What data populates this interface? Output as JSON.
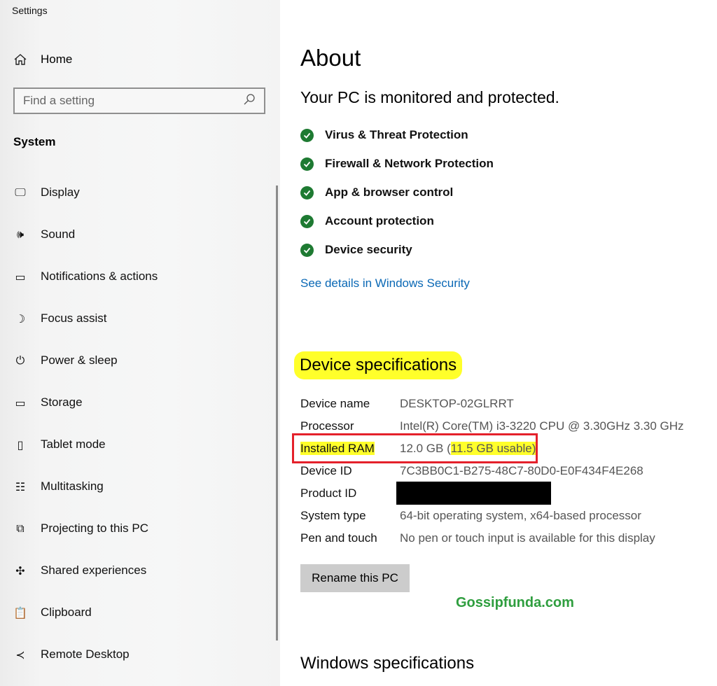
{
  "app": {
    "title": "Settings"
  },
  "sidebar": {
    "home": "Home",
    "search_placeholder": "Find a setting",
    "section": "System",
    "items": [
      {
        "label": "Display",
        "icon": "monitor-icon"
      },
      {
        "label": "Sound",
        "icon": "speaker-icon"
      },
      {
        "label": "Notifications & actions",
        "icon": "notification-icon"
      },
      {
        "label": "Focus assist",
        "icon": "moon-icon"
      },
      {
        "label": "Power & sleep",
        "icon": "power-icon"
      },
      {
        "label": "Storage",
        "icon": "storage-icon"
      },
      {
        "label": "Tablet mode",
        "icon": "tablet-icon"
      },
      {
        "label": "Multitasking",
        "icon": "multitasking-icon"
      },
      {
        "label": "Projecting to this PC",
        "icon": "projecting-icon"
      },
      {
        "label": "Shared experiences",
        "icon": "shared-icon"
      },
      {
        "label": "Clipboard",
        "icon": "clipboard-icon"
      },
      {
        "label": "Remote Desktop",
        "icon": "remote-desktop-icon"
      }
    ]
  },
  "main": {
    "title": "About",
    "protection_heading": "Your PC is monitored and protected.",
    "protection_items": [
      "Virus & Threat Protection",
      "Firewall & Network Protection",
      "App & browser control",
      "Account protection",
      "Device security"
    ],
    "security_link": "See details in Windows Security",
    "specs_heading": "Device specifications",
    "specs": [
      {
        "label": "Device name",
        "value": "DESKTOP-02GLRRT"
      },
      {
        "label": "Processor",
        "value": "Intel(R) Core(TM) i3-3220 CPU @ 3.30GHz   3.30 GHz"
      },
      {
        "label": "Installed RAM",
        "value": "12.0 GB (",
        "value_highlight": "11.5 GB usable)"
      },
      {
        "label": "Device ID",
        "value": "7C3BB0C1-B275-48C7-80D0-E0F434F4E268"
      },
      {
        "label": "Product ID",
        "value": null
      },
      {
        "label": "System type",
        "value": "64-bit operating system, x64-based processor"
      },
      {
        "label": "Pen and touch",
        "value": "No pen or touch input is available for this display"
      }
    ],
    "rename_button": "Rename this PC",
    "watermark": "Gossipfunda.com",
    "windows_heading": "Windows specifications"
  },
  "colors": {
    "check": "#1e7a32",
    "link": "#0a68b5",
    "highlight": "#ffff2a",
    "box": "#e4212b",
    "watermark": "#2f9e3f"
  }
}
